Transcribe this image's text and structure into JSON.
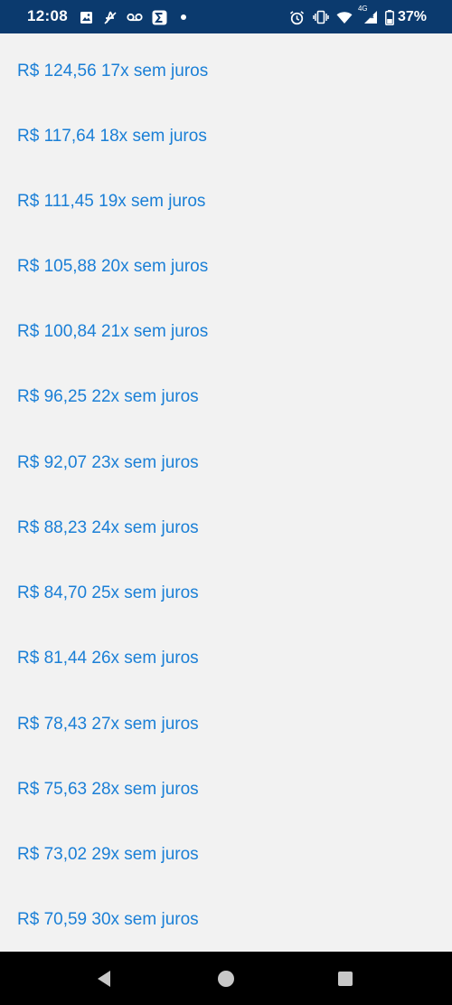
{
  "status_bar": {
    "time": "12:08",
    "battery": "37%",
    "network_label": "4G",
    "left_icons": [
      "gallery-icon",
      "mute-icon",
      "voicemail-icon",
      "sigma-icon",
      "dot-icon"
    ],
    "right_icons": [
      "alarm-icon",
      "vibrate-icon",
      "wifi-icon",
      "signal-icon",
      "battery-icon"
    ]
  },
  "installments": [
    {
      "label": "R$ 124,56 17x sem juros"
    },
    {
      "label": "R$ 117,64 18x sem juros"
    },
    {
      "label": "R$ 111,45 19x sem juros"
    },
    {
      "label": "R$ 105,88 20x sem juros"
    },
    {
      "label": "R$ 100,84 21x sem juros"
    },
    {
      "label": "R$ 96,25 22x sem juros"
    },
    {
      "label": "R$ 92,07 23x sem juros"
    },
    {
      "label": "R$ 88,23 24x sem juros"
    },
    {
      "label": "R$ 84,70 25x sem juros"
    },
    {
      "label": "R$ 81,44 26x sem juros"
    },
    {
      "label": "R$ 78,43 27x sem juros"
    },
    {
      "label": "R$ 75,63 28x sem juros"
    },
    {
      "label": "R$ 73,02 29x sem juros"
    },
    {
      "label": "R$ 70,59 30x sem juros"
    }
  ],
  "nav_bar": {
    "buttons": [
      "back-icon",
      "home-icon",
      "recents-icon"
    ]
  },
  "colors": {
    "status_bar": "#0b3a6e",
    "link_blue": "#1a7fd6",
    "background": "#f2f2f2",
    "nav_bar": "#000000"
  }
}
